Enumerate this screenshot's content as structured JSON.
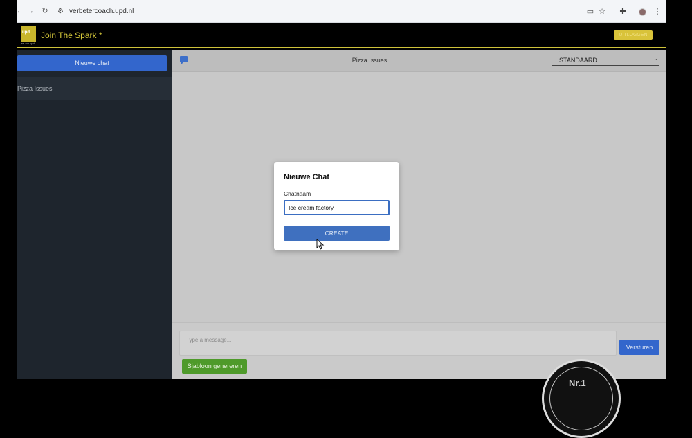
{
  "browser": {
    "url": "verbetercoach.upd.nl",
    "back_glyph": "←",
    "forward_glyph": "→",
    "reload_glyph": "↻"
  },
  "app": {
    "brand": "Join The Spark *",
    "logo_text": "upd",
    "logo_subtext": "we are upd",
    "logout_label": "UITLOGGEN"
  },
  "sidebar": {
    "new_chat_label": "Nieuwe chat",
    "chats": [
      {
        "label": "Pizza Issues"
      }
    ]
  },
  "chat": {
    "title": "Pizza Issues",
    "mode_selected": "STANDAARD",
    "message_placeholder": "Type a message...",
    "send_label": "Versturen",
    "template_label": "Sjabloon genereren"
  },
  "modal": {
    "title": "Nieuwe Chat",
    "field_label": "Chatnaam",
    "field_value": "Ice cream factory",
    "create_label": "CREATE"
  },
  "seal": {
    "text": "Nr.1"
  },
  "colors": {
    "accent_blue": "#3366cc",
    "brand_yellow": "#d4c63a",
    "template_green": "#4e9a2a",
    "sidebar_bg": "#1e252d"
  }
}
